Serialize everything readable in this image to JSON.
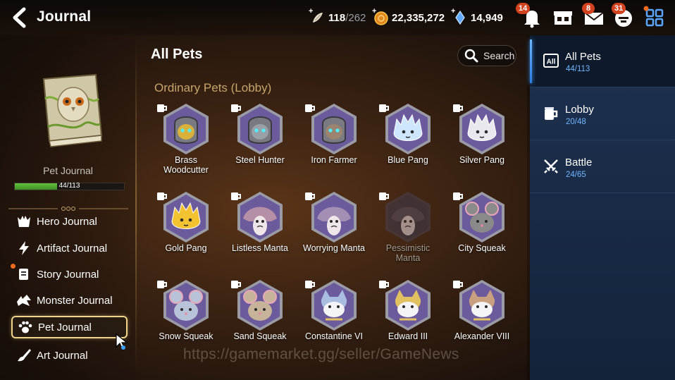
{
  "header": {
    "title": "Journal",
    "stamina": {
      "value": "118",
      "max": "/262"
    },
    "gold": "22,335,272",
    "skystone": "14,949",
    "badges": {
      "notifications": "14",
      "mail": "8",
      "chat": "31"
    }
  },
  "left": {
    "book_name": "Pet Journal",
    "progress_text": "44/113",
    "progress_fraction": 0.389,
    "menu": [
      {
        "label": "Hero Journal"
      },
      {
        "label": "Artifact Journal"
      },
      {
        "label": "Story Journal"
      },
      {
        "label": "Monster Journal"
      },
      {
        "label": "Pet Journal"
      },
      {
        "label": "Art Journal"
      }
    ]
  },
  "main": {
    "title": "All Pets",
    "search_label": "Search",
    "section": "Ordinary Pets (Lobby)",
    "pets": [
      {
        "name": "Brass\nWoodcutter",
        "color": "#6b5a9c",
        "kind": "armor",
        "face": "#d8b23a"
      },
      {
        "name": "Steel Hunter",
        "color": "#6b5a9c",
        "kind": "armor",
        "face": "#9aa0a8"
      },
      {
        "name": "Iron Farmer",
        "color": "#6b5a9c",
        "kind": "armor",
        "face": "#9b8470"
      },
      {
        "name": "Blue Pang",
        "color": "#6b5a9c",
        "kind": "fluff",
        "face": "#cfe6ff"
      },
      {
        "name": "Silver Pang",
        "color": "#6b5a9c",
        "kind": "fluff",
        "face": "#e8e8ee"
      },
      {
        "name": "Gold Pang",
        "color": "#6b5a9c",
        "kind": "fluff",
        "face": "#f2c230"
      },
      {
        "name": "Listless Manta",
        "color": "#6b5a9c",
        "kind": "manta",
        "face": "#b48fa6"
      },
      {
        "name": "Worrying Manta",
        "color": "#6b5a9c",
        "kind": "manta",
        "face": "#a38fb4"
      },
      {
        "name": "Pessimistic\nManta",
        "color": "#3f3a4f",
        "kind": "manta",
        "face": "#5a5266",
        "dim": true
      },
      {
        "name": "City Squeak",
        "color": "#6b5a9c",
        "kind": "mouse",
        "face": "#8a8a8a"
      },
      {
        "name": "Snow Squeak",
        "color": "#6b5a9c",
        "kind": "mouse",
        "face": "#b8c2d8"
      },
      {
        "name": "Sand Squeak",
        "color": "#6b5a9c",
        "kind": "mouse",
        "face": "#c7b39a"
      },
      {
        "name": "Constantine VI",
        "color": "#6b5a9c",
        "kind": "cat",
        "face": "#a8bde0"
      },
      {
        "name": "Edward III",
        "color": "#6b5a9c",
        "kind": "cat",
        "face": "#e0c060"
      },
      {
        "name": "Alexander VIII",
        "color": "#6b5a9c",
        "kind": "cat",
        "face": "#c8a080"
      }
    ]
  },
  "right": {
    "tabs": [
      {
        "name": "All Pets",
        "count": "44/113"
      },
      {
        "name": "Lobby",
        "count": "20/48"
      },
      {
        "name": "Battle",
        "count": "24/65"
      }
    ]
  },
  "watermark": "https://gamemarket.gg/seller/GameNews"
}
